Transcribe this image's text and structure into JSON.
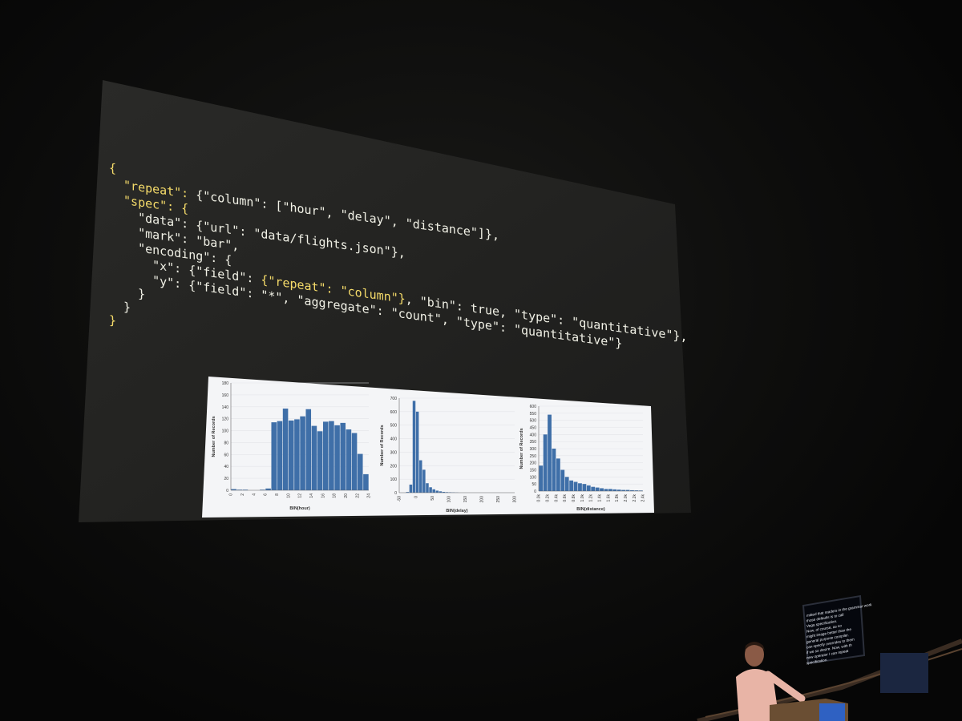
{
  "slide": {
    "code_lines": [
      [
        {
          "t": "{",
          "c": "key"
        }
      ],
      [
        {
          "t": "  \"repeat\": ",
          "c": "key"
        },
        {
          "t": "{\"column\": [\"hour\", \"delay\", \"distance\"]},",
          "c": "txt"
        }
      ],
      [
        {
          "t": "  \"spec\": {",
          "c": "key"
        }
      ],
      [
        {
          "t": "    \"data\": {\"url\": \"data/flights.json\"},",
          "c": "txt"
        }
      ],
      [
        {
          "t": "    \"mark\": \"bar\",",
          "c": "txt"
        }
      ],
      [
        {
          "t": "    \"encoding\": {",
          "c": "txt"
        }
      ],
      [
        {
          "t": "      \"x\": {\"field\": ",
          "c": "txt"
        },
        {
          "t": "{\"repeat\": \"column\"}",
          "c": "key"
        },
        {
          "t": ", \"bin\": true, \"type\": \"quantitative\"},",
          "c": "txt"
        }
      ],
      [
        {
          "t": "      \"y\": {\"field\": \"*\", \"aggregate\": \"count\", \"type\": \"quantitative\"}",
          "c": "txt"
        }
      ],
      [
        {
          "t": "    }",
          "c": "txt"
        }
      ],
      [
        {
          "t": "  }",
          "c": "txt"
        }
      ],
      [
        {
          "t": "}",
          "c": "key"
        }
      ]
    ]
  },
  "colors": {
    "bar": "#3f6fa8",
    "chart_bg": "#f4f5f7",
    "code_text": "#f1f1e6",
    "code_key": "#f6dc6a"
  },
  "chart_data": [
    {
      "type": "bar",
      "title": "",
      "xlabel": "BIN(hour)",
      "ylabel": "Number of Records",
      "ylim": [
        0,
        180
      ],
      "yticks": [
        "0",
        "20",
        "40",
        "60",
        "80",
        "100",
        "120",
        "140",
        "160",
        "180"
      ],
      "xticks": [
        "0",
        "2",
        "4",
        "6",
        "8",
        "10",
        "12",
        "14",
        "16",
        "18",
        "20",
        "22",
        "24"
      ],
      "xlim": [
        0,
        24
      ],
      "bin_width": 1,
      "bins_start": [
        0,
        1,
        2,
        3,
        4,
        5,
        6,
        7,
        8,
        9,
        10,
        11,
        12,
        13,
        14,
        15,
        16,
        17,
        18,
        19,
        20,
        21,
        22,
        23
      ],
      "values": [
        2,
        1,
        1,
        0,
        0,
        1,
        3,
        114,
        116,
        137,
        117,
        119,
        124,
        136,
        108,
        99,
        115,
        116,
        109,
        113,
        102,
        96,
        61,
        27
      ]
    },
    {
      "type": "bar",
      "title": "",
      "xlabel": "BIN(delay)",
      "ylabel": "Number of Records",
      "ylim": [
        0,
        700
      ],
      "yticks": [
        "0",
        "100",
        "200",
        "300",
        "400",
        "500",
        "600",
        "700"
      ],
      "xticks": [
        "-50",
        "0",
        "50",
        "100",
        "150",
        "200",
        "250",
        "300"
      ],
      "xlim": [
        -50,
        300
      ],
      "bin_width": 10,
      "bins_start": [
        -30,
        -20,
        -10,
        0,
        10,
        20,
        30,
        40,
        50,
        60,
        70,
        80,
        90,
        100,
        110,
        120
      ],
      "values": [
        5,
        60,
        680,
        600,
        240,
        170,
        70,
        40,
        25,
        15,
        10,
        6,
        4,
        3,
        2,
        1
      ]
    },
    {
      "type": "bar",
      "title": "",
      "xlabel": "BIN(distance)",
      "ylabel": "Number of Records",
      "ylim": [
        0,
        600
      ],
      "yticks": [
        "0",
        "50",
        "100",
        "150",
        "200",
        "250",
        "300",
        "350",
        "400",
        "450",
        "500",
        "550",
        "600"
      ],
      "xticks": [
        "0.0k",
        "0.2k",
        "0.4k",
        "0.6k",
        "0.8k",
        "1.0k",
        "1.2k",
        "1.4k",
        "1.6k",
        "1.8k",
        "2.0k",
        "2.2k",
        "2.4k"
      ],
      "xlim": [
        0,
        2400
      ],
      "bin_width": 100,
      "bins_start": [
        0,
        100,
        200,
        300,
        400,
        500,
        600,
        700,
        800,
        900,
        1000,
        1100,
        1200,
        1300,
        1400,
        1500,
        1600,
        1700,
        1800,
        1900,
        2000,
        2100,
        2200,
        2300
      ],
      "values": [
        180,
        400,
        540,
        300,
        230,
        150,
        100,
        75,
        65,
        55,
        50,
        40,
        30,
        25,
        20,
        15,
        15,
        12,
        10,
        8,
        8,
        6,
        5,
        4
      ]
    }
  ],
  "caption_monitor": {
    "lines": [
      "mitted that readers in the grammar work",
      "those defaults is to call",
      "Vega specification.",
      "Now, of course, as so",
      "might image better than the",
      "general purpose compiler.",
      "can specify overrides to them",
      "if we so desire. Now, with th",
      "new operator I can repeat",
      "specification."
    ]
  }
}
